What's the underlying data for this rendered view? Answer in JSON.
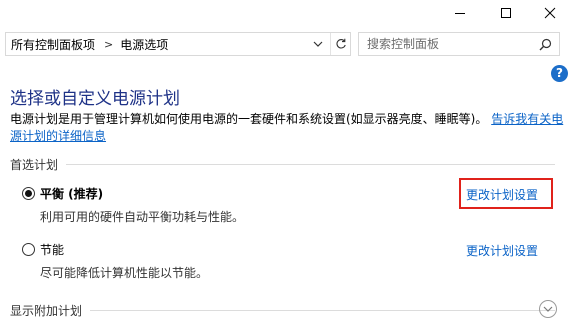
{
  "window": {
    "controls": [
      "minimize-icon",
      "maximize-icon",
      "close-icon"
    ]
  },
  "address_bar": {
    "crumbs": [
      "所有控制面板项",
      "电源选项"
    ],
    "separator": ">",
    "icons": [
      "chevron-down-icon",
      "refresh-icon"
    ]
  },
  "search": {
    "placeholder": "搜索控制面板",
    "icon": "search-icon"
  },
  "help": {
    "label": "?"
  },
  "main": {
    "title": "选择或自定义电源计划",
    "description": "电源计划是用于管理计算机如何使用电源的一套硬件和系统设置(如显示器亮度、睡眠等)。",
    "description_link": "告诉我有关电源计划的详细信息"
  },
  "preferred_plans": {
    "heading": "首选计划",
    "plans": [
      {
        "name": "平衡 (推荐)",
        "description": "利用可用的硬件自动平衡功耗与性能。",
        "selected": true,
        "change_link": "更改计划设置"
      },
      {
        "name": "节能",
        "description": "尽可能降低计算机性能以节能。",
        "selected": false,
        "change_link": "更改计划设置"
      }
    ]
  },
  "additional_plans": {
    "heading": "显示附加计划",
    "icon": "chevron-down-icon"
  },
  "colors": {
    "title": "#1e3287",
    "link": "#0b63c7",
    "highlight": "#e0221b",
    "help": "#1c6ec9"
  }
}
